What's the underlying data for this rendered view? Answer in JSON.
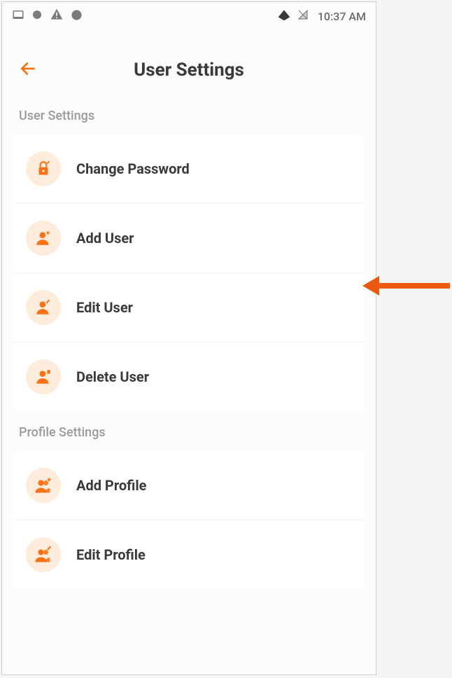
{
  "status_bar": {
    "time": "10:37 AM"
  },
  "header": {
    "title": "User Settings"
  },
  "sections": [
    {
      "title": "User Settings",
      "items": [
        {
          "icon": "lock-edit",
          "label": "Change Password"
        },
        {
          "icon": "user-plus",
          "label": "Add User"
        },
        {
          "icon": "user-edit",
          "label": "Edit User"
        },
        {
          "icon": "user-delete",
          "label": "Delete User"
        }
      ]
    },
    {
      "title": "Profile Settings",
      "items": [
        {
          "icon": "users-plus",
          "label": "Add Profile"
        },
        {
          "icon": "users-edit",
          "label": "Edit Profile"
        }
      ]
    }
  ],
  "colors": {
    "accent": "#f97316",
    "arrow": "#ed5b13",
    "icon_bg": "#fdecdc",
    "text_primary": "#3a3a3a",
    "text_secondary": "#9a9a9a"
  }
}
